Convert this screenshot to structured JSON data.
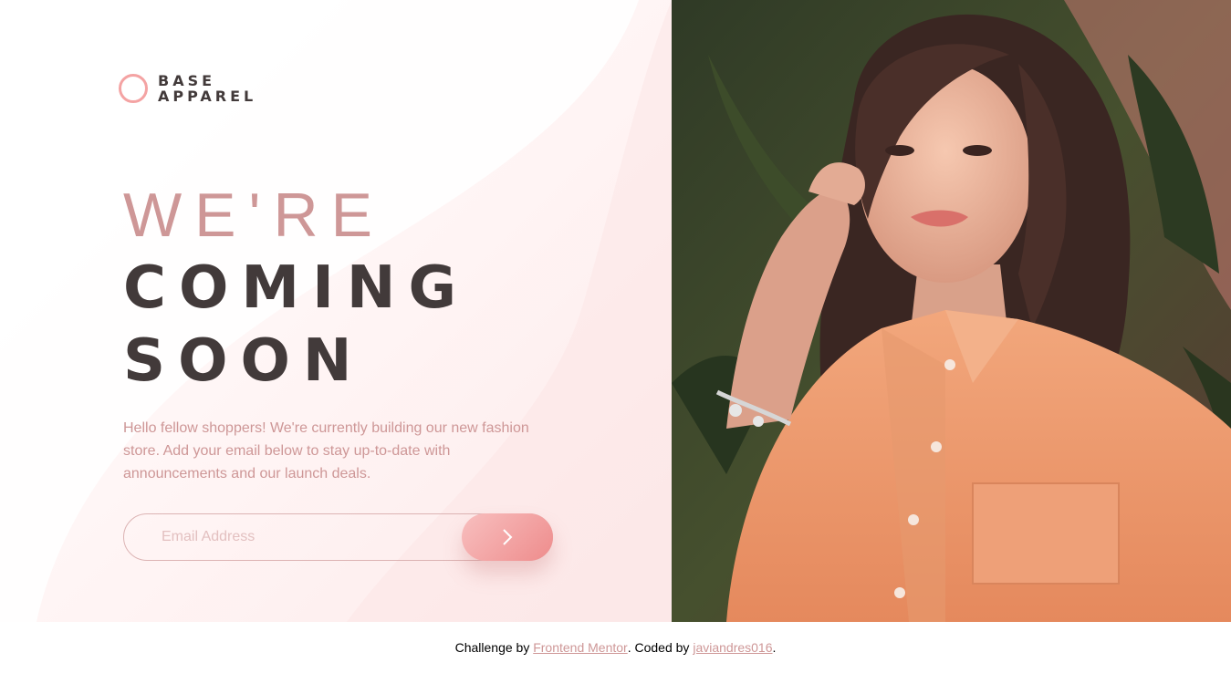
{
  "brand": {
    "line1": "BASE",
    "line2": "APPAREL",
    "accent_color": "#f4a3a3"
  },
  "headline": {
    "light": "WE'RE",
    "bold_line1": "COMING",
    "bold_line2": "SOON"
  },
  "description": "Hello fellow shoppers! We're currently building our new fashion store. Add your email below to stay up-to-date with announcements and our launch deals.",
  "form": {
    "email_placeholder": "Email Address",
    "submit_icon": "chevron-right-icon"
  },
  "hero_image": {
    "icon": "hero-photo"
  },
  "footer": {
    "prefix": "Challenge by ",
    "link1": "Frontend Mentor",
    "middle": ". Coded by ",
    "link2": "javiandres016",
    "suffix": "."
  },
  "colors": {
    "desaturated_red": "#ce9797",
    "dark_grayish_red": "#423a3a",
    "soft_red": "#f96262",
    "gradient_start": "#f8bfbf",
    "gradient_end": "#ee8c8c"
  }
}
